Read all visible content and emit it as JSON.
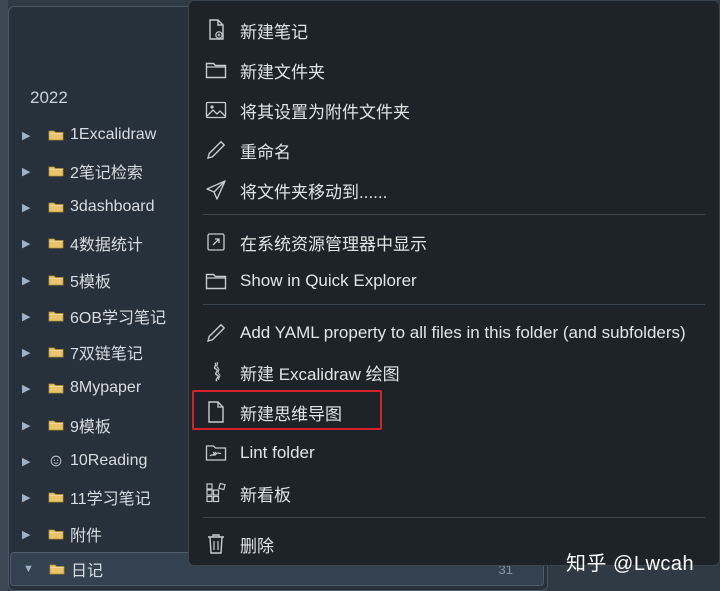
{
  "sidebar": {
    "year": "2022",
    "items": [
      {
        "label": "1Excalidraw",
        "icon": "folder-icon"
      },
      {
        "label": "2笔记检索",
        "icon": "folder-icon"
      },
      {
        "label": "3dashboard",
        "icon": "folder-icon"
      },
      {
        "label": "4数据统计",
        "icon": "folder-icon"
      },
      {
        "label": "5模板",
        "icon": "folder-icon"
      },
      {
        "label": "6OB学习笔记",
        "icon": "folder-icon"
      },
      {
        "label": "7双链笔记",
        "icon": "folder-icon"
      },
      {
        "label": "8Mypaper",
        "icon": "folder-icon"
      },
      {
        "label": "9模板",
        "icon": "folder-icon"
      },
      {
        "label": "10Reading",
        "icon": "emoji-face-icon"
      },
      {
        "label": "11学习笔记",
        "icon": "folder-icon"
      },
      {
        "label": "附件",
        "icon": "folder-icon"
      },
      {
        "label": "日记",
        "icon": "folder-icon",
        "count": "31"
      }
    ]
  },
  "menu": {
    "items": [
      {
        "label": "新建笔记",
        "icon": "new-note-icon"
      },
      {
        "label": "新建文件夹",
        "icon": "folder-outline-icon"
      },
      {
        "label": "将其设置为附件文件夹",
        "icon": "image-icon"
      },
      {
        "label": "重命名",
        "icon": "pencil-icon"
      },
      {
        "label": "将文件夹移动到......",
        "icon": "send-icon"
      },
      {
        "label": "在系统资源管理器中显示",
        "icon": "external-link-icon"
      },
      {
        "label": "Show in Quick Explorer",
        "icon": "folder-outline-icon"
      },
      {
        "label": "Add YAML property to all files in this folder (and subfolders)",
        "icon": "pencil-icon"
      },
      {
        "label": "新建 Excalidraw 绘图",
        "icon": "excalidraw-icon"
      },
      {
        "label": "新建思维导图",
        "icon": "file-icon"
      },
      {
        "label": "Lint folder",
        "icon": "lint-folder-icon"
      },
      {
        "label": "新看板",
        "icon": "kanban-icon"
      },
      {
        "label": "删除",
        "icon": "trash-icon"
      }
    ]
  },
  "watermark": "知乎 @Lwcah",
  "colors": {
    "menu_bg": "#1d2329",
    "highlight": "#d6202a",
    "sidebar_bg": "#27313b"
  }
}
